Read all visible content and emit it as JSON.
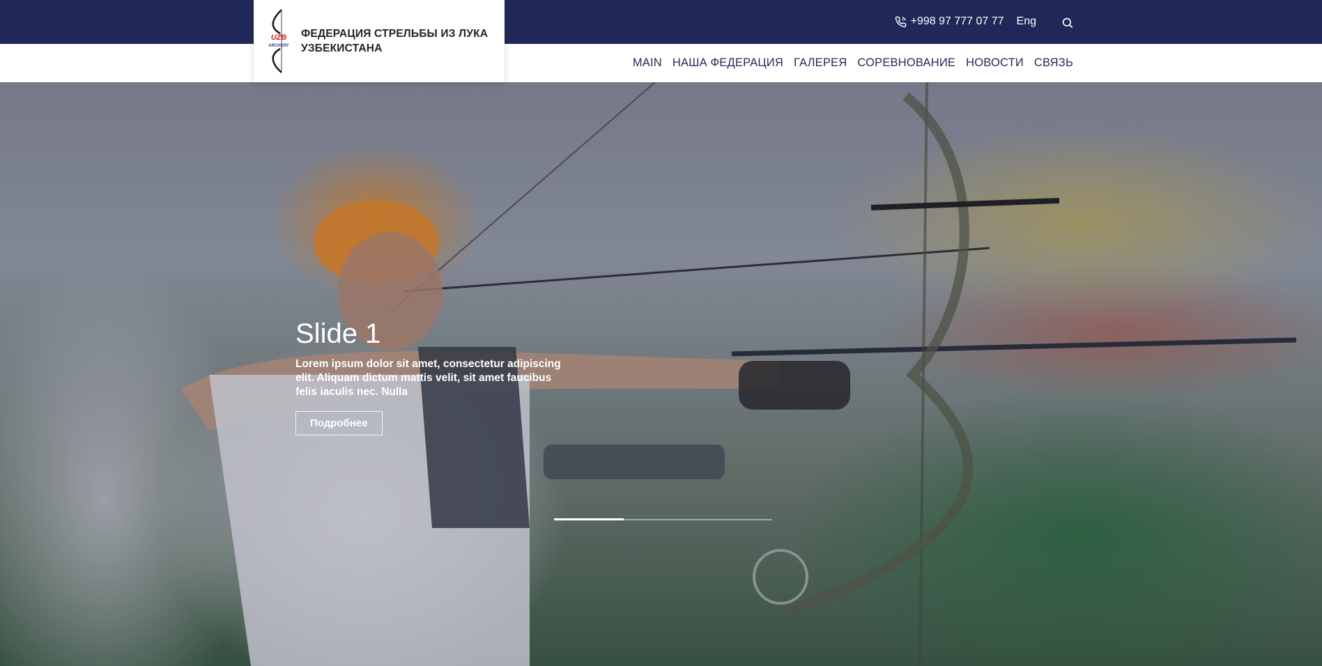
{
  "header": {
    "phone": "+998 97 777 07 77",
    "language": "Eng",
    "logo_text": "ФЕДЕРАЦИЯ СТРЕЛЬБЫ ИЗ ЛУКА УЗБЕКИСТАНА",
    "logo_mark_top": "UZB",
    "logo_mark_bottom": "ARCHERY"
  },
  "nav": {
    "items": [
      {
        "label": "MAIN"
      },
      {
        "label": "НАША ФЕДЕРАЦИЯ"
      },
      {
        "label": "ГАЛЕРЕЯ"
      },
      {
        "label": "СОРЕВНОВАНИЕ"
      },
      {
        "label": "НОВОСТИ"
      },
      {
        "label": "СВЯЗЬ"
      }
    ]
  },
  "hero": {
    "title": "Slide 1",
    "text": "Lorem ipsum dolor sit amet, consectetur adipiscing elit. Aliquam dictum mattis velit, sit amet faucibus felis iaculis nec. Nulla",
    "button": "Подробнее"
  },
  "icons": {
    "phone": "phone-icon",
    "search": "search-icon"
  },
  "colors": {
    "brand_dark": "#1f2858",
    "logo_red": "#d32027",
    "logo_blue": "#2c3e8f"
  }
}
